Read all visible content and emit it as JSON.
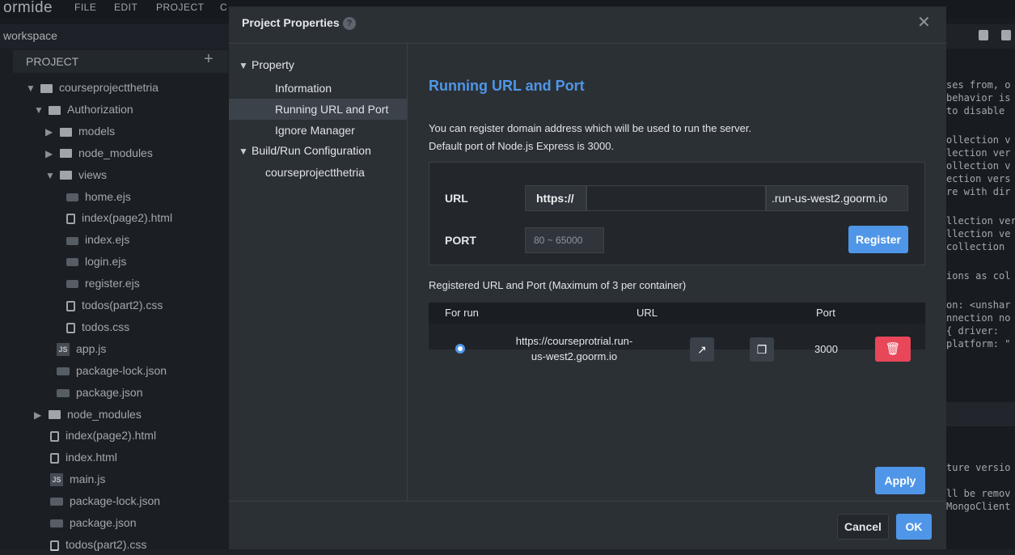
{
  "ide": {
    "brand": "ormide",
    "menu": [
      "FILE",
      "EDIT",
      "PROJECT",
      "C"
    ],
    "workspace": "workspace",
    "project_title": "PROJECT",
    "tree": [
      {
        "label": "courseprojectthetria"
      },
      {
        "label": "Authorization"
      },
      {
        "label": "models"
      },
      {
        "label": "node_modules"
      },
      {
        "label": "views"
      },
      {
        "label": "home.ejs"
      },
      {
        "label": "index(page2).html"
      },
      {
        "label": "index.ejs"
      },
      {
        "label": "login.ejs"
      },
      {
        "label": "register.ejs"
      },
      {
        "label": "todos(part2).css"
      },
      {
        "label": "todos.css"
      },
      {
        "label": "app.js"
      },
      {
        "label": "package-lock.json"
      },
      {
        "label": "package.json"
      },
      {
        "label": "node_modules"
      },
      {
        "label": "index(page2).html"
      },
      {
        "label": "index.html"
      },
      {
        "label": "main.js"
      },
      {
        "label": "package-lock.json"
      },
      {
        "label": "package.json"
      },
      {
        "label": "todos(part2).css"
      }
    ],
    "code_lines": [
      "ses from, o",
      "behavior is",
      "to disable",
      "",
      "ollection v",
      "lection ver",
      "ollection v",
      "ection vers",
      "re with dir",
      "",
      "llection ver",
      "llection ve",
      " collection",
      "",
      "ions as col",
      "",
      "on: <unshar",
      "nnection no",
      " { driver:",
      "platform: \"",
      "ture versio",
      "ll be remov",
      "MongoClient"
    ]
  },
  "modal": {
    "title": "Project Properties",
    "nav": {
      "group1": "Property",
      "items1": [
        "Information",
        "Running URL and Port",
        "Ignore Manager"
      ],
      "group2": "Build/Run Configuration",
      "items2": [
        "courseprojectthetria"
      ]
    },
    "section_title": "Running URL and Port",
    "desc1": "You can register domain address which will be used to run the server.",
    "desc2": "Default port of Node.js Express is 3000.",
    "url_label": "URL",
    "url_prefix": "https://",
    "url_value": "",
    "url_suffix": ".run-us-west2.goorm.io",
    "port_label": "PORT",
    "port_placeholder": "80 ~ 65000",
    "register_label": "Register",
    "registered_title": "Registered URL and Port (Maximum of 3 per container)",
    "table": {
      "headers": [
        "For run",
        "URL",
        "Port"
      ],
      "rows": [
        {
          "url": "https://courseprotrial.run-us-west2.goorm.io",
          "port": "3000",
          "selected": true
        }
      ]
    },
    "apply_label": "Apply",
    "cancel_label": "Cancel",
    "ok_label": "OK",
    "accent": "#4f96e8",
    "danger": "#e84659"
  }
}
